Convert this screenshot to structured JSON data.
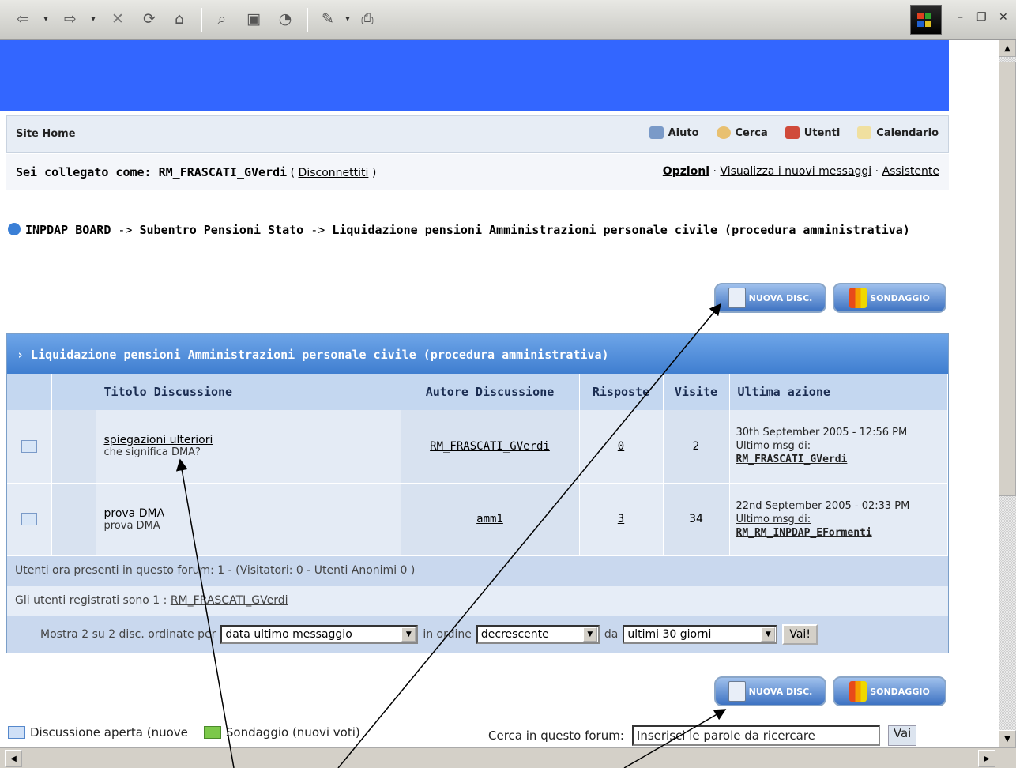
{
  "colors": {
    "banner": "#3366ff",
    "header_blue": "#3f7ed0",
    "row_bg": "#e4ebf5"
  },
  "toolbar": {
    "icons": [
      "back-icon",
      "forward-icon",
      "stop-icon",
      "refresh-icon",
      "home-icon",
      "search-icon",
      "favorites-icon",
      "history-icon",
      "edit-icon",
      "print-icon"
    ],
    "back_glyph": "⇦",
    "forward_glyph": "⇨",
    "dropdown_glyph": "▾",
    "stop_glyph": "✕",
    "refresh_glyph": "⟳",
    "home_glyph": "⌂",
    "search_glyph": "⌕",
    "favorites_glyph": "▣",
    "history_glyph": "◔",
    "edit_glyph": "✎",
    "print_glyph": "⎙",
    "min": "–",
    "restore": "❐",
    "close": "✕"
  },
  "nav": {
    "site_home": "Site Home",
    "links": [
      {
        "label": "Aiuto",
        "icon": "help-icon"
      },
      {
        "label": "Cerca",
        "icon": "search-icon"
      },
      {
        "label": "Utenti",
        "icon": "users-icon"
      },
      {
        "label": "Calendario",
        "icon": "calendar-icon"
      }
    ]
  },
  "status": {
    "logged_in_as": "Sei collegato come: RM_FRASCATI_GVerdi",
    "open_paren": " ( ",
    "logout": "Disconnettiti",
    "close_paren": " )",
    "options": "Opzioni",
    "sep1": " · ",
    "new_messages": "Visualizza i nuovi messaggi",
    "sep2": " · ",
    "assistant": "Assistente"
  },
  "breadcrumb": {
    "board": "INPDAP BOARD",
    "sep1": " -> ",
    "section": "Subentro Pensioni Stato",
    "sep2": " -> ",
    "forum": "Liquidazione pensioni Amministrazioni personale civile (procedura amministrativa)"
  },
  "buttons": {
    "new_topic": "NUOVA DISC.",
    "poll": "SONDAGGIO"
  },
  "forum": {
    "title": "› Liquidazione pensioni Amministrazioni personale civile (procedura amministrativa)",
    "columns": [
      "Titolo Discussione",
      "Autore Discussione",
      "Risposte",
      "Visite",
      "Ultima azione"
    ],
    "threads": [
      {
        "title": "spiegazioni ulteriori",
        "subtitle": "che significa DMA?",
        "author": "RM_FRASCATI_GVerdi",
        "replies": "0",
        "views": "2",
        "last_date": "30th September 2005 - 12:56 PM",
        "last_by_label": "Ultimo msg di:",
        "last_by": "RM_FRASCATI_GVerdi"
      },
      {
        "title": "prova DMA",
        "subtitle": "prova DMA",
        "author": "amm1",
        "replies": "3",
        "views": "34",
        "last_date": "22nd September 2005 - 02:33 PM",
        "last_by_label": "Ultimo msg di:",
        "last_by": "RM_RM_INPDAP_EFormenti"
      }
    ],
    "present": "Utenti ora presenti in questo forum: 1 - (Visitatori: 0 - Utenti Anonimi 0 )",
    "registered_label": "Gli utenti registrati sono 1 : ",
    "registered_user": "RM_FRASCATI_GVerdi",
    "sort": {
      "prefix": "Mostra 2 su 2 disc. ordinate per",
      "sort_by": "data ultimo messaggio",
      "order_label": "in ordine",
      "order": "decrescente",
      "from_label": "da",
      "range": "ultimi 30 giorni",
      "go": "Vai!"
    }
  },
  "legend": {
    "open_topic": "Discussione aperta (nuove",
    "poll_new": "Sondaggio (nuovi voti)"
  },
  "search": {
    "label": "Cerca in questo forum:",
    "placeholder": "Inserisci le parole da ricercare",
    "go": "Vai"
  }
}
